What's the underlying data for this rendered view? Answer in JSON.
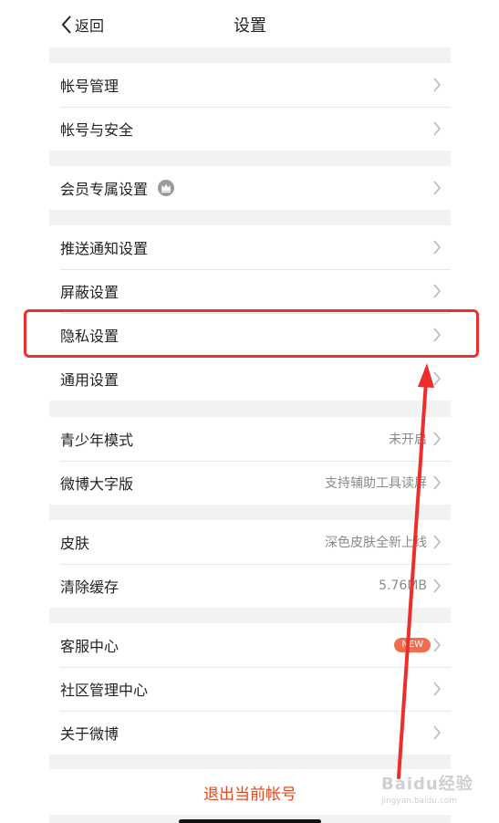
{
  "header": {
    "back_label": "返回",
    "title": "设置"
  },
  "groups": {
    "g1": {
      "items": [
        {
          "label": "帐号管理"
        },
        {
          "label": "帐号与安全"
        }
      ]
    },
    "g2": {
      "items": [
        {
          "label": "会员专属设置",
          "icon": "crown-icon"
        }
      ]
    },
    "g3": {
      "items": [
        {
          "label": "推送通知设置"
        },
        {
          "label": "屏蔽设置"
        },
        {
          "label": "隐私设置"
        },
        {
          "label": "通用设置"
        }
      ]
    },
    "g4": {
      "items": [
        {
          "label": "青少年模式",
          "value": "未开启"
        },
        {
          "label": "微博大字版",
          "value": "支持辅助工具读屏"
        }
      ]
    },
    "g5": {
      "items": [
        {
          "label": "皮肤",
          "value": "深色皮肤全新上线"
        },
        {
          "label": "清除缓存",
          "value": "5.76MB"
        }
      ]
    },
    "g6": {
      "items": [
        {
          "label": "客服中心",
          "badge": "NEW"
        },
        {
          "label": "社区管理中心"
        },
        {
          "label": "关于微博"
        }
      ]
    }
  },
  "logout_label": "退出当前帐号",
  "watermark": {
    "main": "Baidu经验",
    "sub": "jingyan.baidu.com"
  },
  "colors": {
    "accent": "#e0471d",
    "highlight": "#f02d2d",
    "badge": "#f26c4f"
  }
}
